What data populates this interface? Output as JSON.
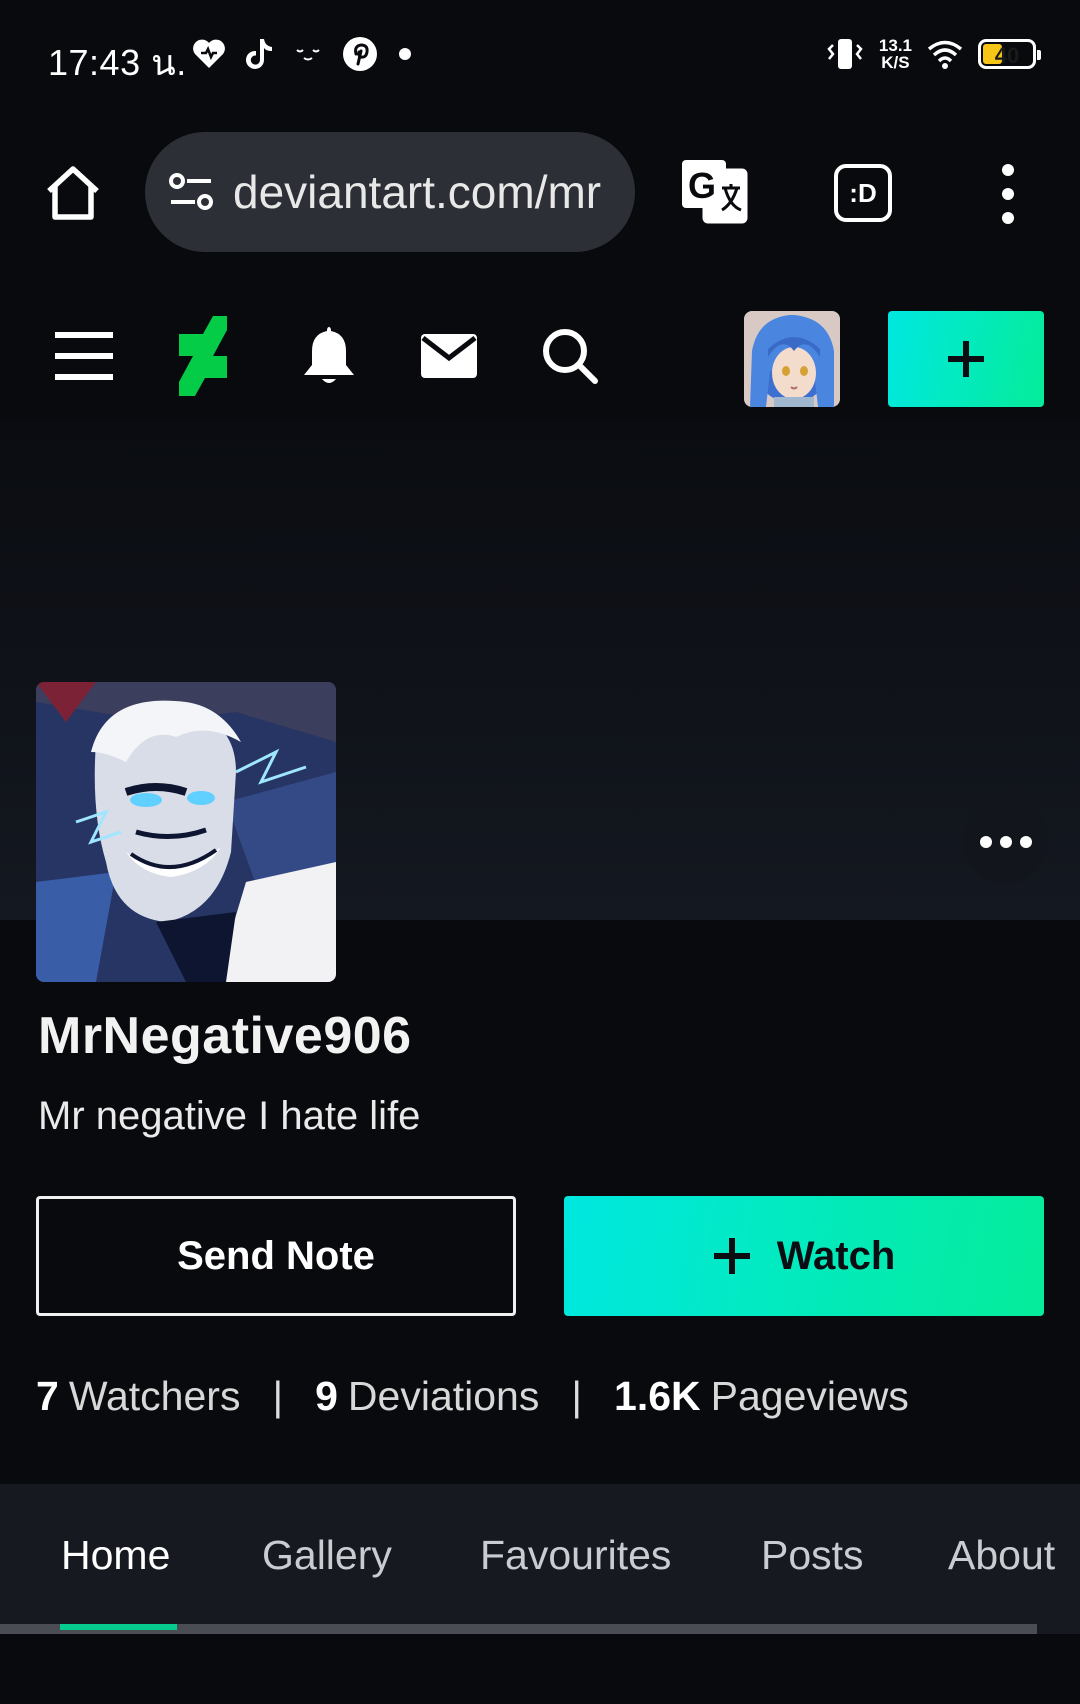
{
  "status_bar": {
    "time": "17:43 น.",
    "net_speed_value": "13.1",
    "net_speed_unit": "K/S",
    "battery_level": "40",
    "icons_left": [
      "heart-icon",
      "tiktok-icon",
      "face-icon",
      "pinterest-icon",
      "dot-icon"
    ],
    "icons_right": [
      "vibrate-icon",
      "wifi-icon",
      "battery-icon"
    ]
  },
  "browser": {
    "url": "deviantart.com/mr",
    "dev_button_label": ":D"
  },
  "site_nav": {
    "icons": [
      "menu-icon",
      "deviantart-logo-icon",
      "bell-icon",
      "mail-icon",
      "search-icon"
    ],
    "create_label": "+"
  },
  "profile": {
    "username": "MrNegative906",
    "tagline": "Mr negative I hate life",
    "send_note_label": "Send Note",
    "watch_icon": "+",
    "watch_label": "Watch",
    "stats": [
      {
        "value": "7",
        "label": "Watchers"
      },
      {
        "value": "9",
        "label": "Deviations"
      },
      {
        "value": "1.6K",
        "label": "Pageviews"
      }
    ],
    "separator": "|"
  },
  "tabs": [
    {
      "label": "Home",
      "active": true
    },
    {
      "label": "Gallery",
      "active": false
    },
    {
      "label": "Favourites",
      "active": false
    },
    {
      "label": "Posts",
      "active": false
    },
    {
      "label": "About",
      "active": false
    }
  ],
  "colors": {
    "accent_gradient_start": "#00e8e0",
    "accent_gradient_end": "#05ec9a",
    "background": "#080a0e",
    "tab_bar": "#16191f",
    "tab_indicator": "#05cc8e"
  }
}
